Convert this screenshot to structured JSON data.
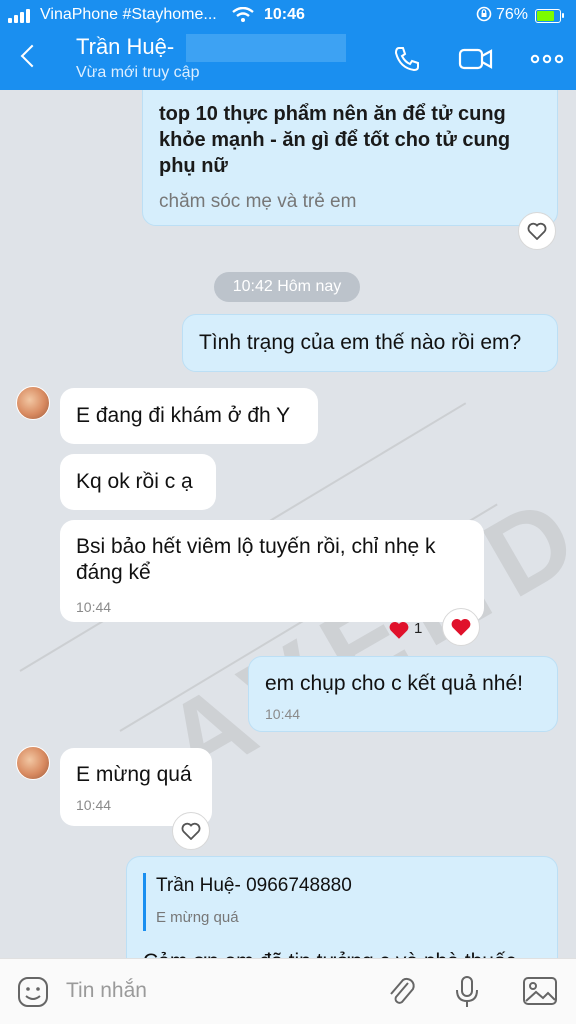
{
  "status_bar": {
    "carrier": "VinaPhone #Stayhome...",
    "time": "10:46",
    "battery": "76%",
    "battery_level": 0.76
  },
  "header": {
    "contact_name": "Trần Huệ-",
    "subtitle": "Vừa mới truy cập"
  },
  "watermark": "LAVENDA",
  "messages": {
    "link_card": {
      "partial_text": "",
      "title": "top 10 thực phẩm nên ăn để tử cung khỏe mạnh - ăn gì để tốt cho tử cung phụ nữ",
      "source": "chăm sóc mẹ và trẻ em"
    },
    "date_divider": "10:42 Hôm nay",
    "out_1": {
      "text": "Tình trạng của em thế nào rồi em?"
    },
    "in_1": {
      "text": "E đang đi khám ở đh Y"
    },
    "in_2": {
      "text": "Kq ok rồi c ạ"
    },
    "in_3": {
      "text": "Bsi bảo hết viêm lộ tuyến rồi, chỉ nhẹ k đáng kể",
      "time": "10:44",
      "reaction_count": "1"
    },
    "out_2": {
      "text": "em chụp cho c kết quả nhé!",
      "time": "10:44"
    },
    "in_4": {
      "text": "E mừng quá",
      "time": "10:44"
    },
    "out_3": {
      "quote_name": "Trần Huệ- 0966748880",
      "quote_text": "E mừng quá",
      "text": "Cảm ơn em đã tin tưởng c và nhà thuốc"
    }
  },
  "input_bar": {
    "placeholder": "Tin nhắn"
  },
  "colors": {
    "header_blue": "#1a8ff0",
    "out_bubble": "#d6eefc",
    "in_bubble": "#ffffff",
    "chat_bg": "#dfe3e8",
    "heart_red": "#e0112b"
  },
  "icons": [
    "back-icon",
    "phone-icon",
    "video-icon",
    "more-icon",
    "heart-outline-icon",
    "heart-filled-icon",
    "sticker-icon",
    "attach-icon",
    "mic-icon",
    "image-icon",
    "wifi-icon",
    "rotation-lock-icon"
  ]
}
